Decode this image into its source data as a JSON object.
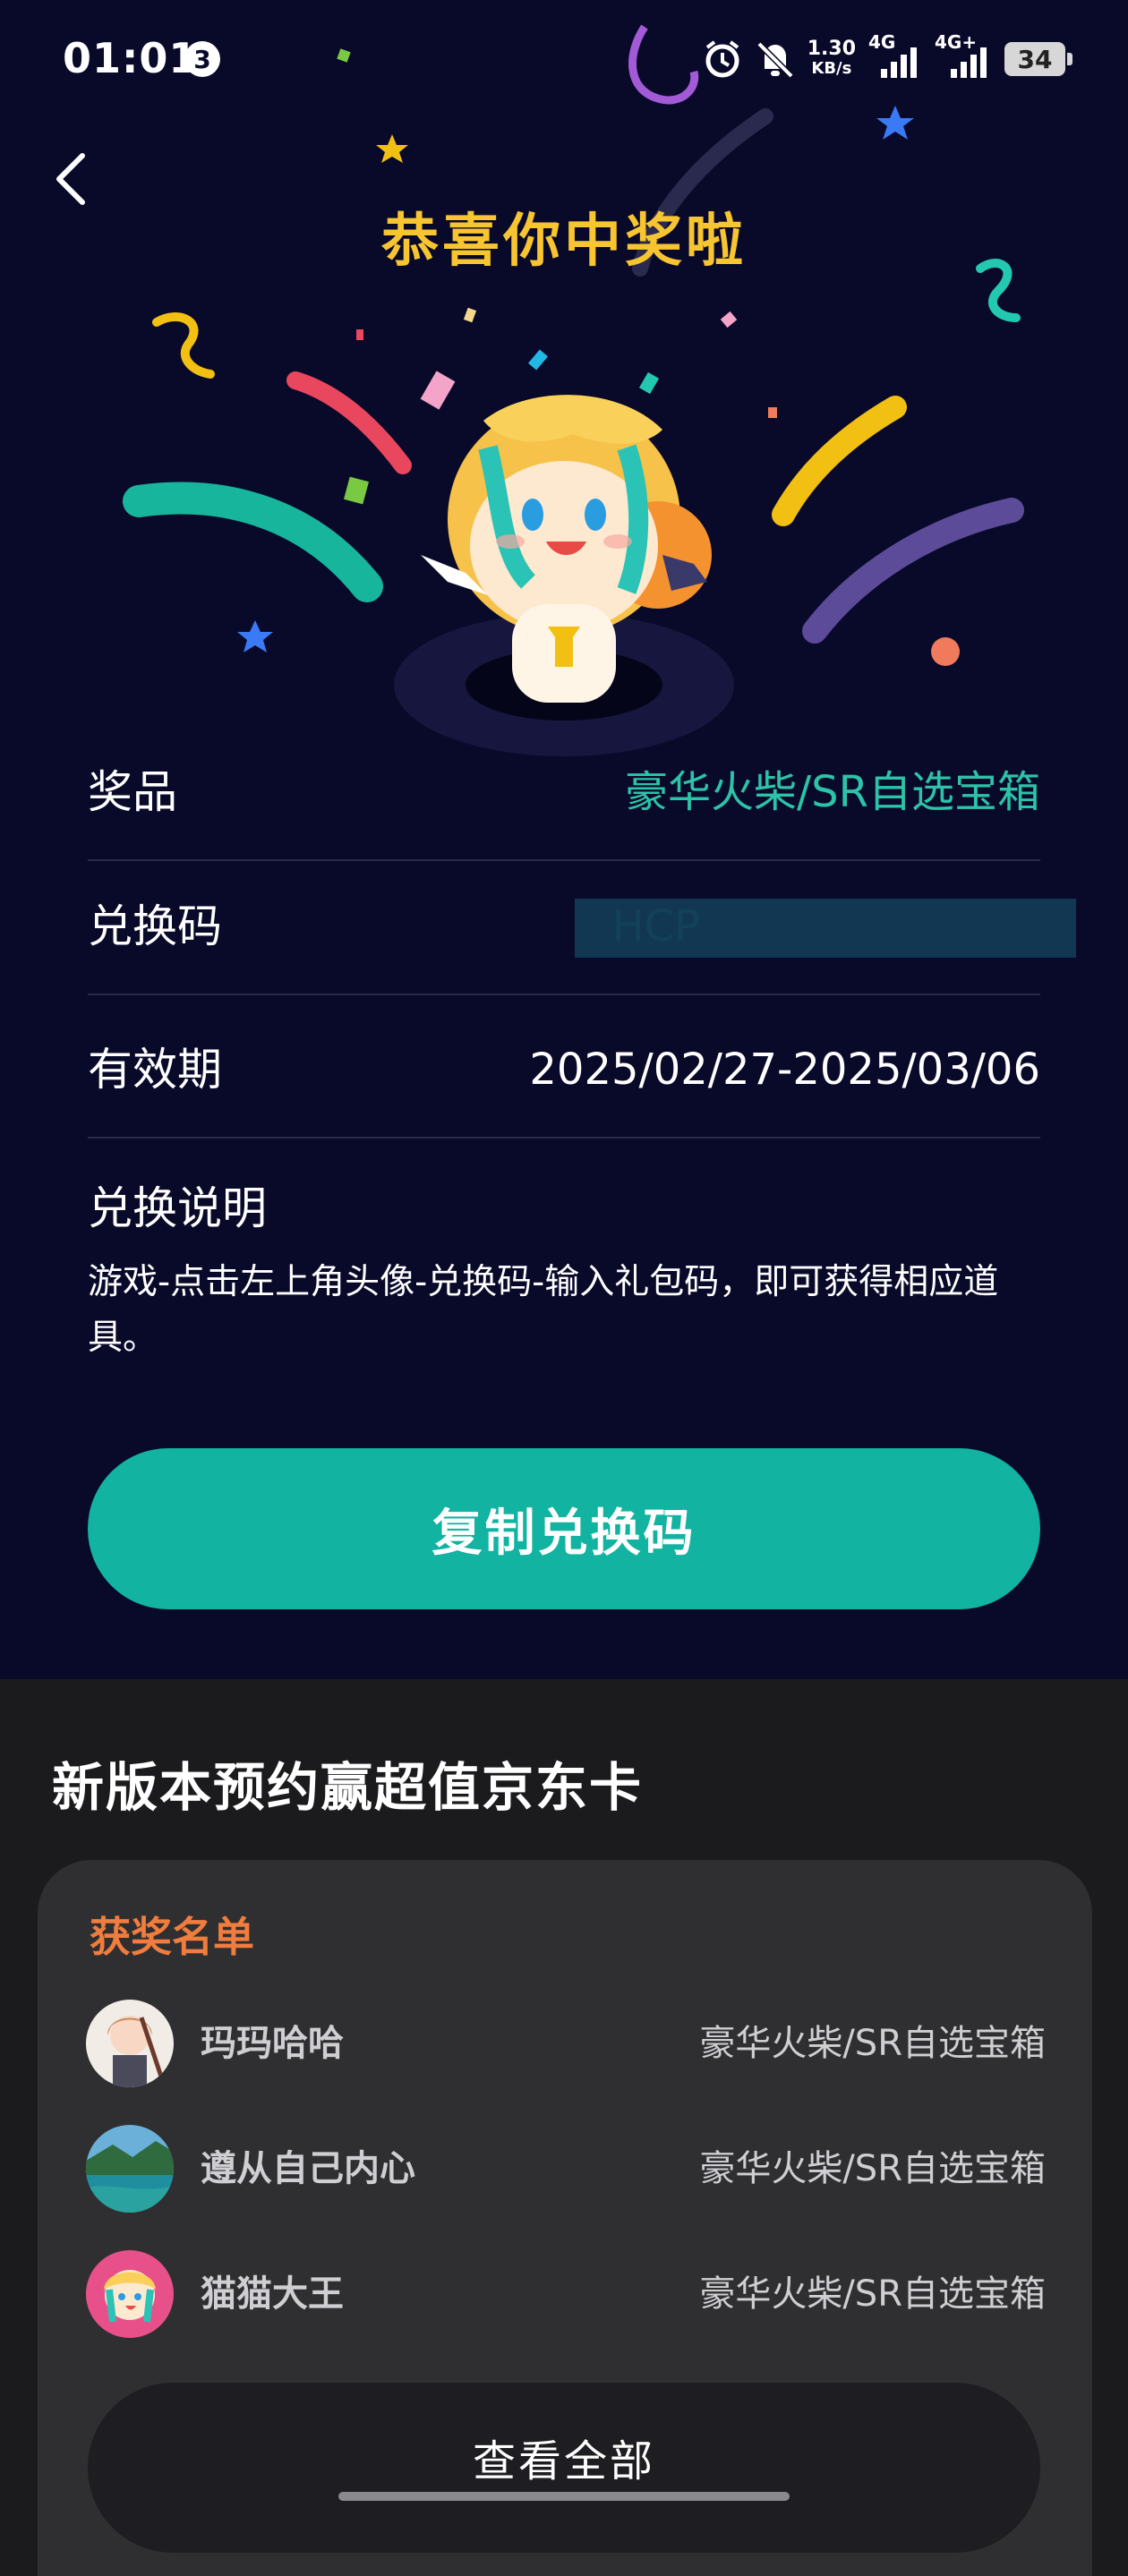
{
  "status_bar": {
    "time": "01:01",
    "notification_count": "3",
    "network_speed_value": "1.30",
    "network_speed_unit": "KB/s",
    "signal1_label": "4G",
    "signal2_label": "4G+",
    "battery": "34"
  },
  "header": {
    "title": "恭喜你中奖啦"
  },
  "prize_info": {
    "prize_label": "奖品",
    "prize_value": "豪华火柴/SR自选宝箱",
    "code_label": "兑换码",
    "code_value": "HCP",
    "validity_label": "有效期",
    "validity_value": "2025/02/27-2025/03/06",
    "instructions_label": "兑换说明",
    "instructions_text": "游戏-点击左上角头像-兑换码-输入礼包码，即可获得相应道具。"
  },
  "copy_button": {
    "label": "复制兑换码"
  },
  "promo": {
    "title": "新版本预约赢超值京东卡",
    "winners_title": "获奖名单",
    "winners": [
      {
        "name": "玛玛哈哈",
        "prize": "豪华火柴/SR自选宝箱"
      },
      {
        "name": "遵从自己内心",
        "prize": "豪华火柴/SR自选宝箱"
      },
      {
        "name": "猫猫大王",
        "prize": "豪华火柴/SR自选宝箱"
      }
    ],
    "view_all_label": "查看全部"
  },
  "icons": {
    "back": "chevron-left-icon",
    "alarm": "alarm-icon",
    "mute": "bell-off-icon"
  },
  "colors": {
    "background": "#09092a",
    "title": "#f7c531",
    "accent": "#12b3a1",
    "prize_text": "#2cc3a8",
    "winners_title": "#f07c3d"
  }
}
